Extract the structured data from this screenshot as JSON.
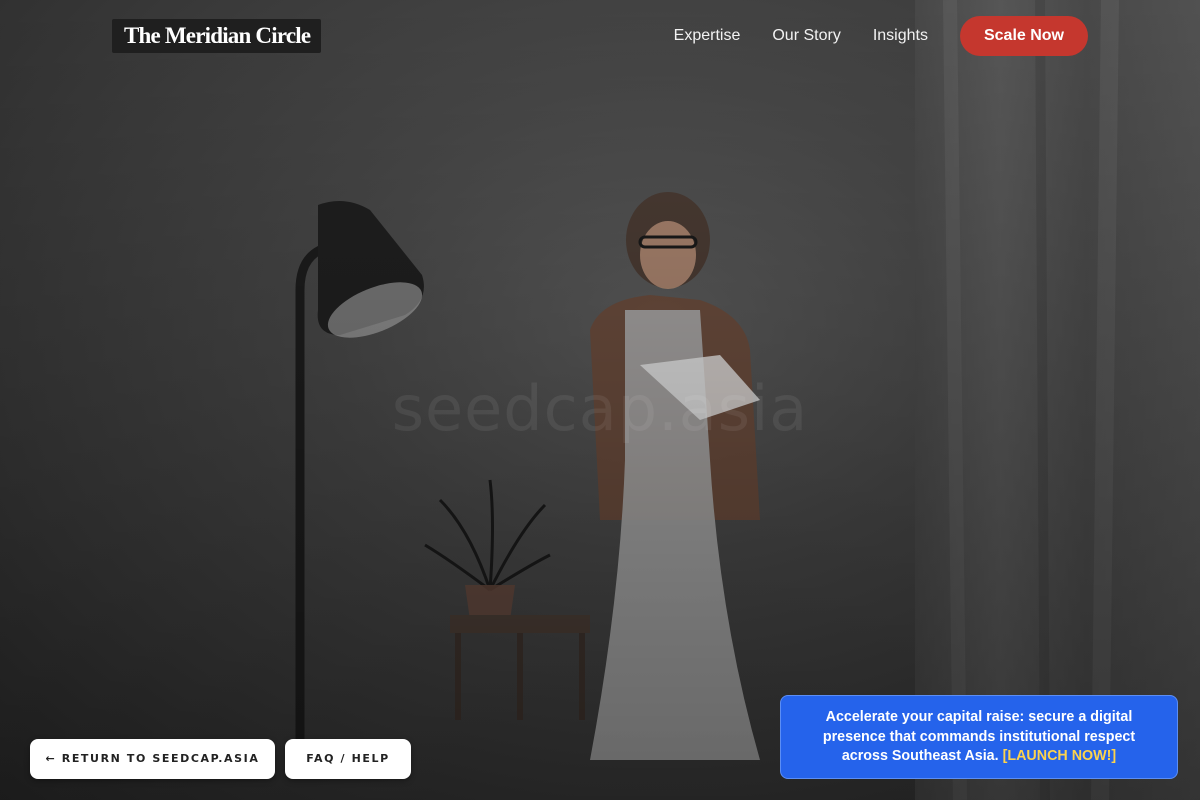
{
  "header": {
    "logo": "The Meridian Circle",
    "nav": [
      "Expertise",
      "Our Story",
      "Insights"
    ],
    "cta_label": "Scale Now"
  },
  "hero": {
    "watermark": "seedcap.asia"
  },
  "footer_buttons": {
    "back_label": "← RETURN TO SEEDCAP.ASIA",
    "faq_label": "FAQ / HELP"
  },
  "banner": {
    "text": "Accelerate your capital raise: secure a digital presence that commands institutional respect across Southeast Asia.",
    "link_label": "[LAUNCH NOW!]"
  },
  "colors": {
    "cta": "#c5372e",
    "banner": "#2563eb",
    "banner_link": "#fcd34d"
  }
}
